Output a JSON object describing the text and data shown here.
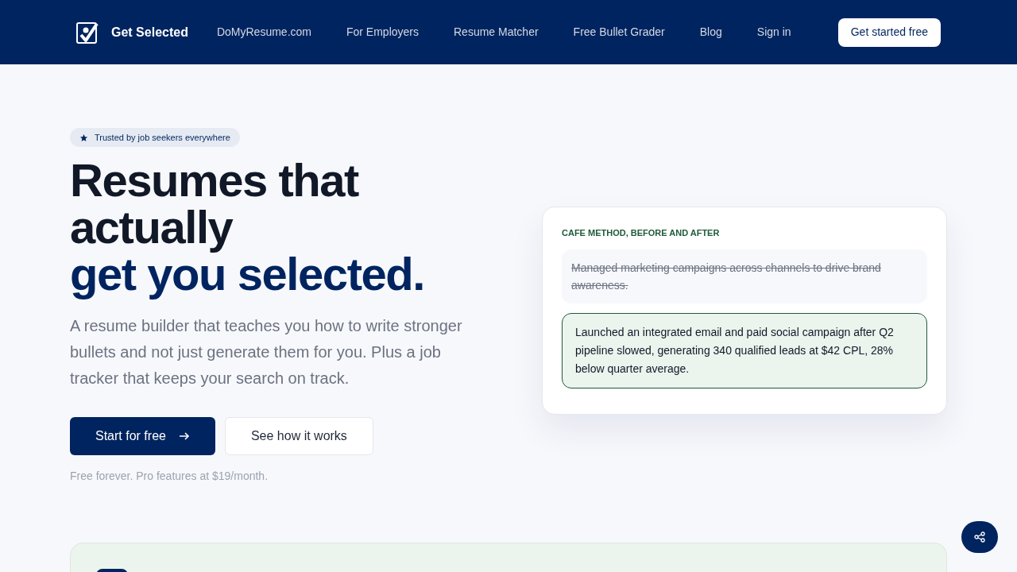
{
  "nav": {
    "brand": "Get Selected",
    "links": [
      "DoMyResume.com",
      "For Employers",
      "Resume Matcher",
      "Free Bullet Grader",
      "Blog",
      "Sign in"
    ],
    "cta": "Get started free"
  },
  "hero": {
    "badge": "Trusted by job seekers everywhere",
    "title_dark": "Resumes that actually",
    "title_accent": "get you selected.",
    "lead": "A resume builder that teaches you how to write stronger bullets and not just generate them for you. Plus a job tracker that keeps your search on track.",
    "primary": "Start for free",
    "secondary": "See how it works",
    "note": "Free forever. Pro features at $19/month."
  },
  "card": {
    "label": "CAFE METHOD, BEFORE AND AFTER",
    "bullets": [
      {
        "kind": "before",
        "text": "Managed marketing campaigns across channels to drive brand awareness."
      },
      {
        "kind": "after",
        "text": "Launched an integrated email and paid social campaign after Q2 pipeline slowed, generating 340 qualified leads at $42 CPL, 28% below quarter average."
      }
    ]
  }
}
